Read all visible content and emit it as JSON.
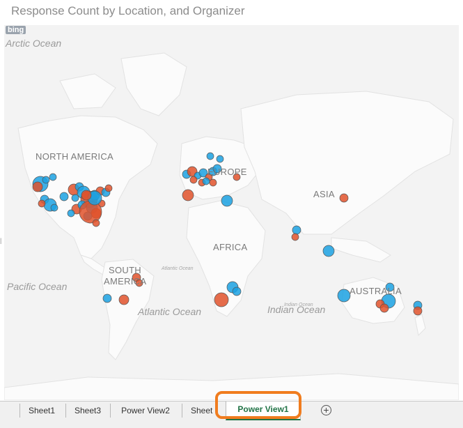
{
  "report": {
    "title": "Response Count by Location, and Organizer"
  },
  "map": {
    "provider_logo": "bing",
    "oceans": {
      "arctic": "Arctic Ocean",
      "pacific": "Pacific Ocean",
      "atlantic": "Atlantic Ocean",
      "atlantic_small": "Atlantic Ocean",
      "indian": "Indian Ocean",
      "indian_small": "Indian Ocean"
    },
    "continents": {
      "north_america": "NORTH AMERICA",
      "europe": "EUROPE",
      "asia": "ASIA",
      "africa": "AFRICA",
      "south_america_1": "SOUTH",
      "south_america_2": "AMERICA",
      "australia": "AUSTRALIA"
    },
    "colors": {
      "series_a": "#1ba1e2",
      "series_b": "#e1522b",
      "land": "#fbfbfb",
      "water": "#f1f1f1"
    }
  },
  "sheet_tabs": {
    "tabs": [
      "Sheet1",
      "Sheet3",
      "Power View2",
      "Sheet",
      "Power View1"
    ],
    "active": "Power View1",
    "add_icon": "plus-circle-icon"
  }
}
